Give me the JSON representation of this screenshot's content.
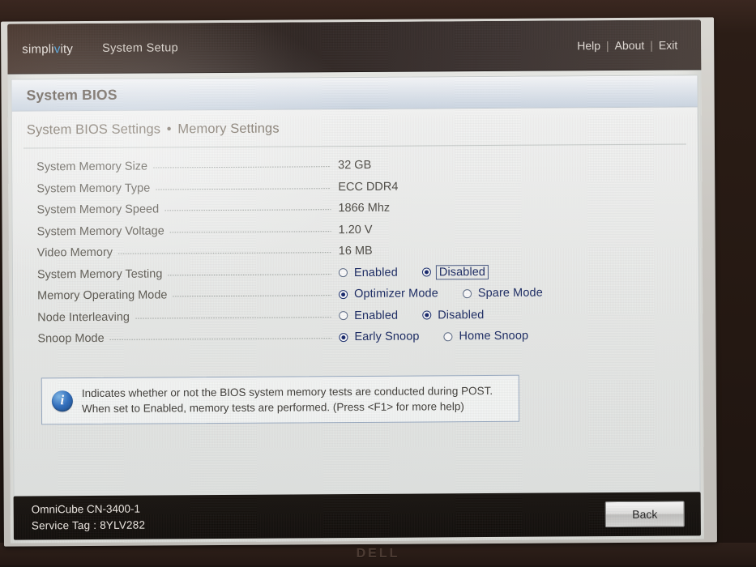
{
  "monitor": {
    "bezel_logo": "DELL"
  },
  "topbar": {
    "brand_pre": "simpli",
    "brand_v": "v",
    "brand_post": "ity",
    "app_title": "System Setup",
    "nav": [
      {
        "label": "Help",
        "name": "help-link"
      },
      {
        "label": "About",
        "name": "about-link"
      },
      {
        "label": "Exit",
        "name": "exit-link"
      }
    ],
    "nav_separator": "|"
  },
  "panel": {
    "heading": "System BIOS",
    "breadcrumb_parent": "System BIOS Settings",
    "breadcrumb_sep": "•",
    "breadcrumb_current": "Memory Settings"
  },
  "settings": [
    {
      "label": "System Memory Size",
      "type": "readonly",
      "value": "32 GB"
    },
    {
      "label": "System Memory Type",
      "type": "readonly",
      "value": "ECC DDR4"
    },
    {
      "label": "System Memory Speed",
      "type": "readonly",
      "value": "1866 Mhz"
    },
    {
      "label": "System Memory Voltage",
      "type": "readonly",
      "value": "1.20 V"
    },
    {
      "label": "Video Memory",
      "type": "readonly",
      "value": "16 MB"
    },
    {
      "label": "System Memory Testing",
      "type": "radio",
      "options": [
        {
          "label": "Enabled",
          "selected": false,
          "focused": false
        },
        {
          "label": "Disabled",
          "selected": true,
          "focused": true
        }
      ]
    },
    {
      "label": "Memory Operating Mode",
      "type": "radio",
      "options": [
        {
          "label": "Optimizer Mode",
          "selected": true,
          "focused": false
        },
        {
          "label": "Spare Mode",
          "selected": false,
          "focused": false
        }
      ]
    },
    {
      "label": "Node Interleaving",
      "type": "radio",
      "options": [
        {
          "label": "Enabled",
          "selected": false,
          "focused": false
        },
        {
          "label": "Disabled",
          "selected": true,
          "focused": false
        }
      ]
    },
    {
      "label": "Snoop Mode",
      "type": "radio",
      "options": [
        {
          "label": "Early Snoop",
          "selected": true,
          "focused": false
        },
        {
          "label": "Home Snoop",
          "selected": false,
          "focused": false
        }
      ]
    }
  ],
  "help": {
    "icon": "info-icon",
    "line1": "Indicates whether or not the BIOS system memory tests are conducted during POST.",
    "line2": "When set to Enabled, memory tests are performed. (Press <F1> for more help)"
  },
  "statusbar": {
    "system_name": "OmniCube CN-3400-1",
    "service_tag_label": "Service Tag :",
    "service_tag_value": "8YLV282",
    "back_label": "Back"
  },
  "colors": {
    "topbar_dark": "#2e2522",
    "panel_header": "#cdd8e4",
    "radio_selected": "#15266b",
    "option_text": "#1a2a63",
    "info_blue": "#2f6fc0",
    "bezel": "#241812"
  }
}
